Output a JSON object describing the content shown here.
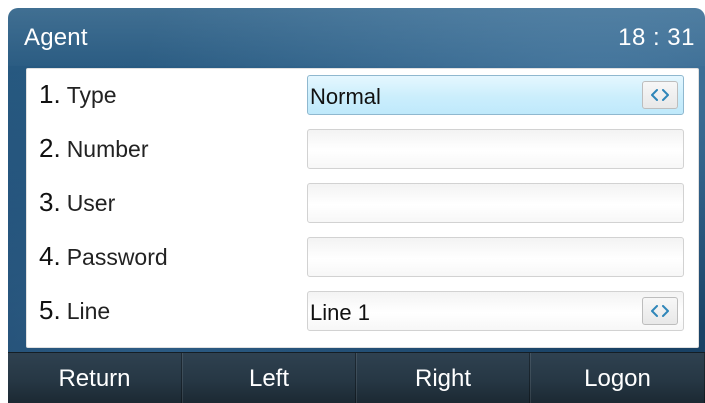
{
  "title_bar": {
    "title": "Agent",
    "time": "18 : 31"
  },
  "form": {
    "rows": [
      {
        "number": "1.",
        "label": "Type",
        "value": "Normal",
        "has_selector": true,
        "selected": true
      },
      {
        "number": "2.",
        "label": "Number",
        "value": "",
        "has_selector": false,
        "selected": false
      },
      {
        "number": "3.",
        "label": "User",
        "value": "",
        "has_selector": false,
        "selected": false
      },
      {
        "number": "4.",
        "label": "Password",
        "value": "",
        "has_selector": false,
        "selected": false
      },
      {
        "number": "5.",
        "label": "Line",
        "value": "Line 1",
        "has_selector": true,
        "selected": false
      }
    ]
  },
  "softkeys": [
    {
      "label": "Return"
    },
    {
      "label": "Left"
    },
    {
      "label": "Right"
    },
    {
      "label": "Logon"
    }
  ],
  "icons": {
    "selector": "left-right-arrows-icon"
  },
  "colors": {
    "selector_arrow": "#2f86b9",
    "selected_field_top": "#e5f7ff",
    "selected_field_bottom": "#bfe9fb"
  }
}
